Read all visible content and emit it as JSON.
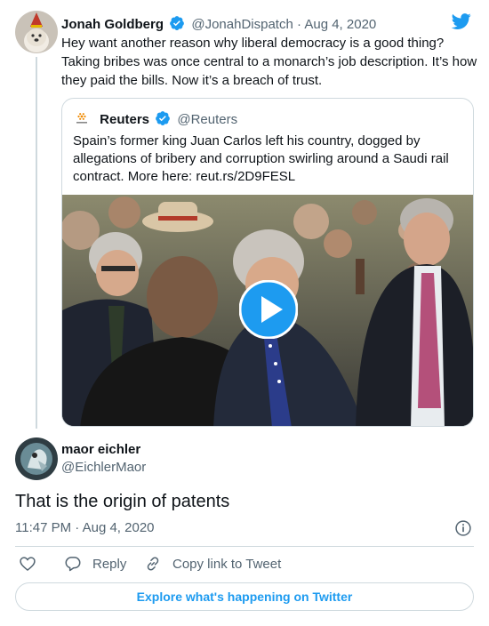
{
  "parent": {
    "name": "Jonah Goldberg",
    "handle": "@JonahDispatch",
    "separator": " · ",
    "date": "Aug 4, 2020",
    "text": "Hey want another reason why liberal democracy is a good thing? Taking bribes was once  central to a monarch’s job description. It’s how they paid the bills. Now it’s a breach of trust."
  },
  "quoted": {
    "name": "Reuters",
    "handle": "@Reuters",
    "text": "Spain’s former king Juan Carlos left his country, dogged by allegations of bribery and corruption swirling around a Saudi rail contract. More here: reut.rs/2D9FESL"
  },
  "reply": {
    "name": "maor eichler",
    "handle": "@EichlerMaor",
    "text": "That is the origin of patents",
    "time": "11:47 PM",
    "separator": " · ",
    "date": "Aug 4, 2020"
  },
  "actions": {
    "reply_label": "Reply",
    "copy_label": "Copy link to Tweet"
  },
  "explore_label": "Explore what's happening on Twitter",
  "colors": {
    "accent": "#1d9bf0",
    "text": "#0f1419",
    "secondary": "#536471",
    "border": "#cfd9de"
  },
  "icons": [
    "verified-badge-icon",
    "twitter-bird-icon",
    "play-icon",
    "info-icon",
    "heart-icon",
    "reply-icon",
    "link-icon"
  ]
}
